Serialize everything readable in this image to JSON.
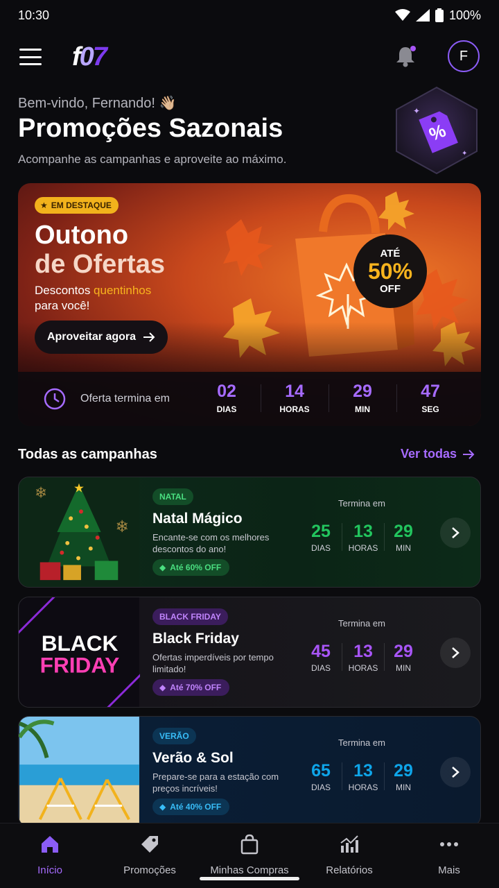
{
  "status": {
    "time": "10:30",
    "battery": "100%"
  },
  "header": {
    "logo_f": "f",
    "logo_o": "0",
    "logo_7": "7",
    "avatar_initial": "F"
  },
  "greeting": "Bem-vindo, Fernando! 👋🏼",
  "page_title": "Promoções Sazonais",
  "page_subtitle": "Acompanhe as campanhas e aproveite ao máximo.",
  "hero": {
    "badge": "EM DESTAQUE",
    "title_line1": "Outono",
    "title_line2": "de Ofertas",
    "desc_before": "Descontos ",
    "desc_highlight": "quentinhos",
    "desc_after": "para você!",
    "cta": "Aproveitar agora",
    "off_top": "ATÉ",
    "off_value": "50%",
    "off_bottom": "OFF",
    "countdown_label": "Oferta termina em",
    "countdown": [
      {
        "value": "02",
        "label": "DIAS"
      },
      {
        "value": "14",
        "label": "HORAS"
      },
      {
        "value": "29",
        "label": "MIN"
      },
      {
        "value": "47",
        "label": "SEG"
      }
    ]
  },
  "campaigns_section": {
    "title": "Todas as campanhas",
    "see_all": "Ver todas"
  },
  "campaigns": [
    {
      "tag": "NATAL",
      "title": "Natal Mágico",
      "desc": "Encante-se com os melhores descontos do ano!",
      "discount": "Até 60% OFF",
      "ends_label": "Termina em",
      "countdown": [
        {
          "value": "25",
          "label": "DIAS"
        },
        {
          "value": "13",
          "label": "HORAS"
        },
        {
          "value": "29",
          "label": "MIN"
        }
      ],
      "accent": "#22c55e"
    },
    {
      "tag": "BLACK FRIDAY",
      "title": "Black Friday",
      "desc": "Ofertas imperdíveis por tempo limitado!",
      "discount": "Até 70% OFF",
      "ends_label": "Termina em",
      "image_text_1": "BLACK",
      "image_text_2": "FRIDAY",
      "countdown": [
        {
          "value": "45",
          "label": "DIAS"
        },
        {
          "value": "13",
          "label": "HORAS"
        },
        {
          "value": "29",
          "label": "MIN"
        }
      ],
      "accent": "#a855f7"
    },
    {
      "tag": "VERÃO",
      "title": "Verão & Sol",
      "desc": "Prepare-se para a estação com preços incríveis!",
      "discount": "Até 40% OFF",
      "ends_label": "Termina em",
      "countdown": [
        {
          "value": "65",
          "label": "DIAS"
        },
        {
          "value": "13",
          "label": "HORAS"
        },
        {
          "value": "29",
          "label": "MIN"
        }
      ],
      "accent": "#0ea5e9"
    }
  ],
  "bottom_nav": [
    {
      "label": "Início",
      "icon": "home-icon"
    },
    {
      "label": "Promoções",
      "icon": "tag-icon"
    },
    {
      "label": "Minhas Compras",
      "icon": "shopping-bag-icon"
    },
    {
      "label": "Relatórios",
      "icon": "chart-icon"
    },
    {
      "label": "Mais",
      "icon": "more-icon"
    }
  ]
}
